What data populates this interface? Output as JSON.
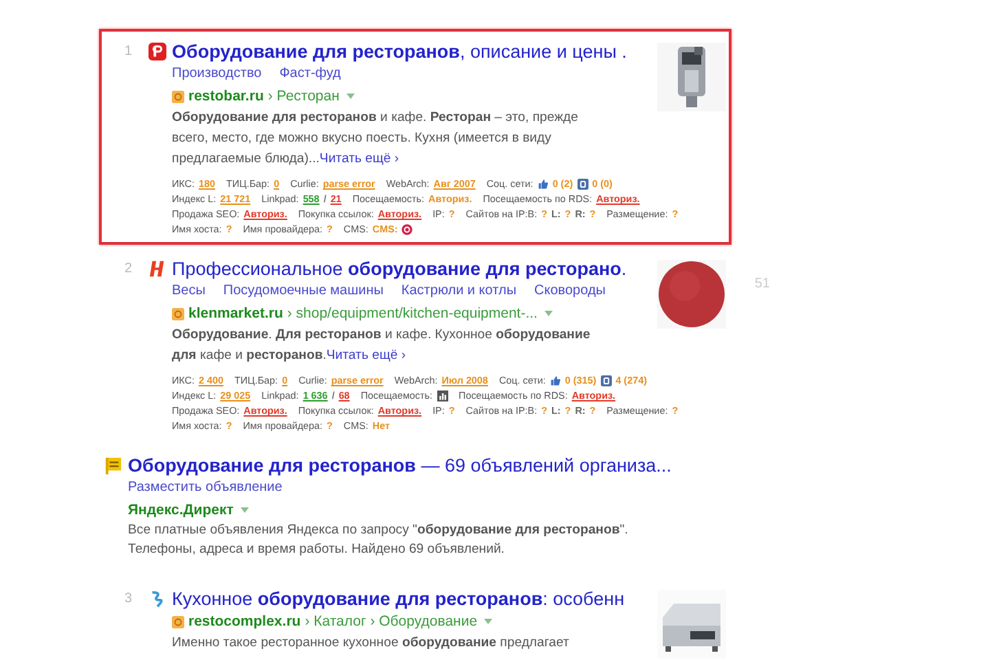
{
  "results": [
    {
      "kind": "organic",
      "number": "1",
      "highlighted": true,
      "title": "**Оборудование для ресторанов**, описание и цены .",
      "sitelinks": [
        "Производство",
        "Фаст-фуд"
      ],
      "domain": "restobar.ru",
      "path": "› Ресторан",
      "snippet": "**Оборудование для ресторанов** и кафе. **Ресторан** – это, прежде всего, место, где можно вкусно поесть. Кухня (имеется в виду предлагаемые блюда)...",
      "read_more": "Читать ещё ›",
      "seo": [
        [
          {
            "label": "ИКС:",
            "parts": [
              {
                "kind": "text",
                "text": "180",
                "color": "#e8901c",
                "link": true
              }
            ]
          },
          {
            "label": "ТИЦ.Бар:",
            "parts": [
              {
                "kind": "text",
                "text": "0",
                "color": "#e8901c",
                "link": true
              }
            ]
          },
          {
            "label": "Curlie:",
            "parts": [
              {
                "kind": "text",
                "text": "parse error",
                "color": "#e8901c",
                "link": true
              }
            ]
          },
          {
            "label": "WebArch:",
            "parts": [
              {
                "kind": "text",
                "text": "Авг 2007",
                "color": "#e8901c",
                "link": true
              }
            ]
          },
          {
            "label": "Соц. сети:",
            "parts": [
              {
                "kind": "like"
              },
              {
                "kind": "text",
                "text": "0 (2)",
                "color": "#e8901c",
                "link": false
              },
              {
                "kind": "vk"
              },
              {
                "kind": "text",
                "text": "0 (0)",
                "color": "#e8901c",
                "link": false
              }
            ]
          }
        ],
        [
          {
            "label": "Индекс L:",
            "parts": [
              {
                "kind": "text",
                "text": "21 721",
                "color": "#e8901c",
                "link": true
              }
            ]
          },
          {
            "label": "Linkpad:",
            "parts": [
              {
                "kind": "text",
                "text": "558",
                "color": "#2e9e2e",
                "link": true
              },
              {
                "kind": "text",
                "text": "/",
                "color": "#777777",
                "link": false
              },
              {
                "kind": "text",
                "text": "21",
                "color": "#e03a2a",
                "link": true
              }
            ]
          },
          {
            "label": "Посещаемость:",
            "parts": [
              {
                "kind": "text",
                "text": "Авториз.",
                "color": "#e8901c",
                "link": false
              }
            ]
          },
          {
            "label": "Посещаемость по RDS:",
            "parts": [
              {
                "kind": "text",
                "text": "Авториз.",
                "color": "#e03a2a",
                "link": true
              }
            ]
          }
        ],
        [
          {
            "label": "Продажа SEO:",
            "parts": [
              {
                "kind": "text",
                "text": "Авториз.",
                "color": "#e03a2a",
                "link": true
              }
            ]
          },
          {
            "label": "Покупка ссылок:",
            "parts": [
              {
                "kind": "text",
                "text": "Авториз.",
                "color": "#e03a2a",
                "link": true
              }
            ]
          },
          {
            "label": "IP:",
            "parts": [
              {
                "kind": "text",
                "text": "?",
                "color": "#e8901c",
                "link": false
              }
            ]
          },
          {
            "label": "Сайтов на IP:B:",
            "parts": [
              {
                "kind": "text",
                "text": "?",
                "color": "#e8901c",
                "link": false
              },
              {
                "kind": "text",
                "text": "L:",
                "color": "#666666",
                "link": false
              },
              {
                "kind": "text",
                "text": "?",
                "color": "#e8901c",
                "link": false
              },
              {
                "kind": "text",
                "text": "R:",
                "color": "#666666",
                "link": false
              },
              {
                "kind": "text",
                "text": "?",
                "color": "#e8901c",
                "link": false
              }
            ]
          },
          {
            "label": "Размещение:",
            "parts": [
              {
                "kind": "text",
                "text": "?",
                "color": "#e8901c",
                "link": false
              }
            ]
          }
        ],
        [
          {
            "label": "Имя хоста:",
            "parts": [
              {
                "kind": "text",
                "text": "?",
                "color": "#e8901c",
                "link": false
              }
            ]
          },
          {
            "label": "Имя провайдера:",
            "parts": [
              {
                "kind": "text",
                "text": "?",
                "color": "#e8901c",
                "link": false
              }
            ]
          },
          {
            "label": "CMS:",
            "parts": [
              {
                "kind": "text",
                "text": "CMS:",
                "color": "#e8901c",
                "link": false
              },
              {
                "kind": "badge"
              }
            ]
          }
        ]
      ]
    },
    {
      "kind": "organic",
      "number": "2",
      "title": "Профессиональное **оборудование для ресторано**.",
      "sitelinks": [
        "Весы",
        "Посудомоечные машины",
        "Кастрюли и котлы",
        "Сковороды"
      ],
      "domain": "klenmarket.ru",
      "path": "› shop/equipment/kitchen-equipment-...",
      "snippet": "**Оборудование**. **Для ресторанов** и кафе. Кухонное **оборудование для** кафе и **ресторанов**.",
      "read_more": "Читать ещё ›",
      "side_count": "51",
      "seo": [
        [
          {
            "label": "ИКС:",
            "parts": [
              {
                "kind": "text",
                "text": "2 400",
                "color": "#e8901c",
                "link": true
              }
            ]
          },
          {
            "label": "ТИЦ.Бар:",
            "parts": [
              {
                "kind": "text",
                "text": "0",
                "color": "#e8901c",
                "link": true
              }
            ]
          },
          {
            "label": "Curlie:",
            "parts": [
              {
                "kind": "text",
                "text": "parse error",
                "color": "#e8901c",
                "link": true
              }
            ]
          },
          {
            "label": "WebArch:",
            "parts": [
              {
                "kind": "text",
                "text": "Июл 2008",
                "color": "#e8901c",
                "link": true
              }
            ]
          },
          {
            "label": "Соц. сети:",
            "parts": [
              {
                "kind": "like"
              },
              {
                "kind": "text",
                "text": "0 (315)",
                "color": "#e8901c",
                "link": false
              },
              {
                "kind": "vk"
              },
              {
                "kind": "text",
                "text": "4 (274)",
                "color": "#e8901c",
                "link": false
              }
            ]
          }
        ],
        [
          {
            "label": "Индекс L:",
            "parts": [
              {
                "kind": "text",
                "text": "29 025",
                "color": "#e8901c",
                "link": true
              }
            ]
          },
          {
            "label": "Linkpad:",
            "parts": [
              {
                "kind": "text",
                "text": "1 636",
                "color": "#2e9e2e",
                "link": true
              },
              {
                "kind": "text",
                "text": "/",
                "color": "#777777",
                "link": false
              },
              {
                "kind": "text",
                "text": "68",
                "color": "#e03a2a",
                "link": true
              }
            ]
          },
          {
            "label": "Посещаемость:",
            "parts": [
              {
                "kind": "chart"
              }
            ]
          },
          {
            "label": "Посещаемость по RDS:",
            "parts": [
              {
                "kind": "text",
                "text": "Авториз.",
                "color": "#e03a2a",
                "link": true
              }
            ]
          }
        ],
        [
          {
            "label": "Продажа SEO:",
            "parts": [
              {
                "kind": "text",
                "text": "Авториз.",
                "color": "#e03a2a",
                "link": true
              }
            ]
          },
          {
            "label": "Покупка ссылок:",
            "parts": [
              {
                "kind": "text",
                "text": "Авториз.",
                "color": "#e03a2a",
                "link": true
              }
            ]
          },
          {
            "label": "IP:",
            "parts": [
              {
                "kind": "text",
                "text": "?",
                "color": "#e8901c",
                "link": false
              }
            ]
          },
          {
            "label": "Сайтов на IP:B:",
            "parts": [
              {
                "kind": "text",
                "text": "?",
                "color": "#e8901c",
                "link": false
              },
              {
                "kind": "text",
                "text": "L:",
                "color": "#666666",
                "link": false
              },
              {
                "kind": "text",
                "text": "?",
                "color": "#e8901c",
                "link": false
              },
              {
                "kind": "text",
                "text": "R:",
                "color": "#666666",
                "link": false
              },
              {
                "kind": "text",
                "text": "?",
                "color": "#e8901c",
                "link": false
              }
            ]
          },
          {
            "label": "Размещение:",
            "parts": [
              {
                "kind": "text",
                "text": "?",
                "color": "#e8901c",
                "link": false
              }
            ]
          }
        ],
        [
          {
            "label": "Имя хоста:",
            "parts": [
              {
                "kind": "text",
                "text": "?",
                "color": "#e8901c",
                "link": false
              }
            ]
          },
          {
            "label": "Имя провайдера:",
            "parts": [
              {
                "kind": "text",
                "text": "?",
                "color": "#e8901c",
                "link": false
              }
            ]
          },
          {
            "label": "CMS:",
            "parts": [
              {
                "kind": "text",
                "text": "Нет",
                "color": "#e8901c",
                "link": false
              }
            ]
          }
        ]
      ]
    },
    {
      "kind": "direct",
      "title": "**Оборудование для ресторанов** — 69 объявлений организа...",
      "sitelinks": [
        "Разместить объявление"
      ],
      "domain": "Яндекс.Директ",
      "snippet": "Все платные объявления Яндекса по запросу \"**оборудование для ресторанов**\". Телефоны, адреса и время работы. Найдено 69 объявлений."
    },
    {
      "kind": "organic",
      "number": "3",
      "title": "Кухонное **оборудование для ресторанов**: особенн",
      "domain": "restocomplex.ru",
      "path": "› Каталог › Оборудование",
      "snippet": "Именно такое ресторанное кухонное **оборудование** предлагает"
    }
  ]
}
